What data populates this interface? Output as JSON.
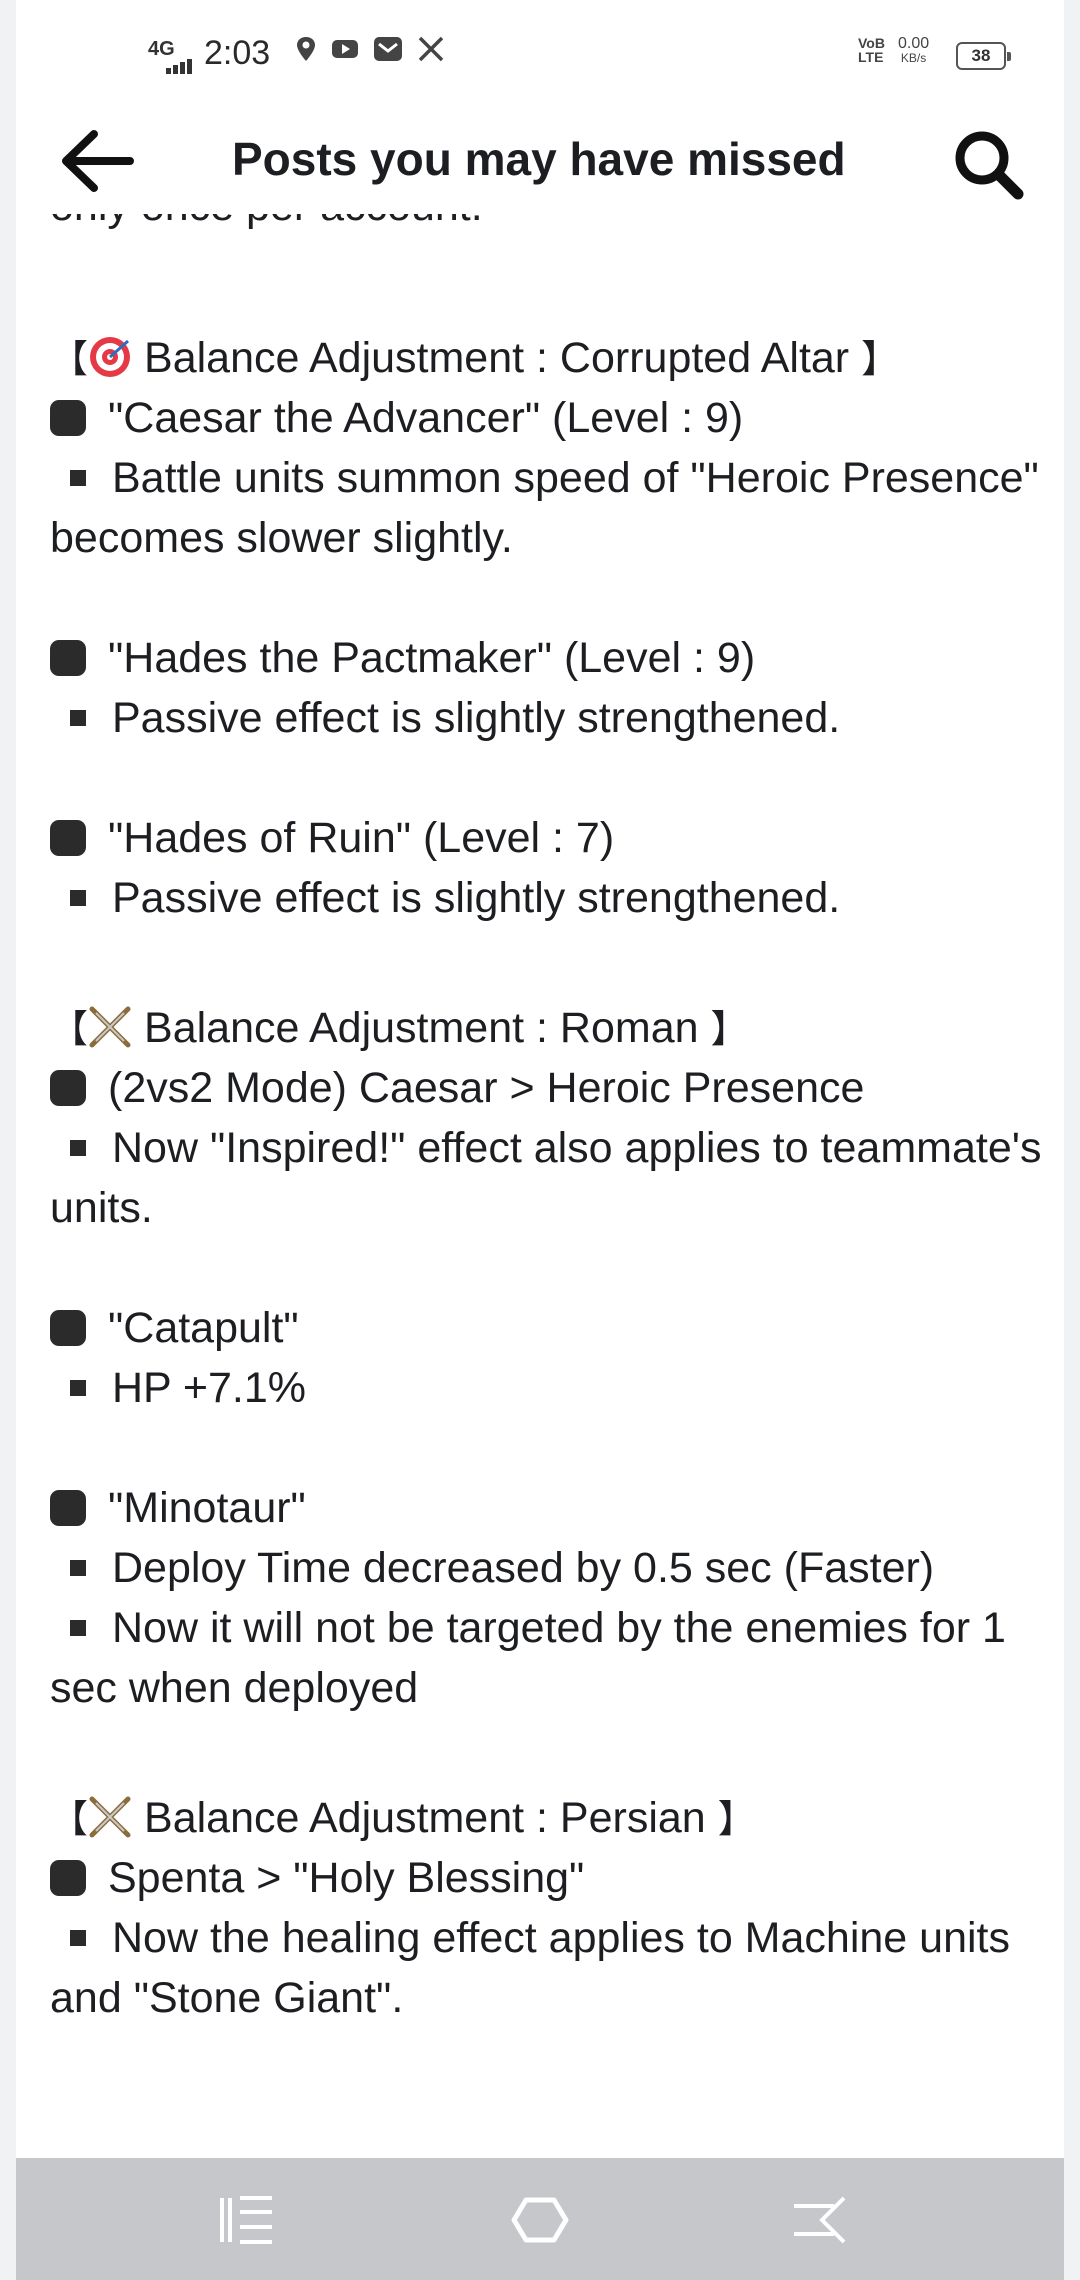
{
  "status_bar": {
    "network": "4G",
    "time": "2:03",
    "volte": "VoB",
    "lte": "LTE",
    "speed_value": "0.00",
    "speed_unit": "KB/s",
    "battery": "38"
  },
  "header": {
    "title": "Posts you may have missed"
  },
  "post": {
    "cut_off_text": "only once per account.",
    "sections": [
      {
        "bracket_open": "【",
        "icon": "target-icon",
        "heading": "Balance Adjustment : Corrupted Altar",
        "bracket_close": "】",
        "items": [
          {
            "title": "\"Caesar the Advancer\" (Level : 9)",
            "details": [
              "Battle units summon speed of \"Heroic Presence\" becomes slower slightly."
            ]
          },
          {
            "title": "\"Hades the Pactmaker\" (Level : 9)",
            "details": [
              "Passive effect is slightly strengthened."
            ]
          },
          {
            "title": "\"Hades of Ruin\" (Level : 7)",
            "details": [
              "Passive effect is slightly strengthened."
            ]
          }
        ]
      },
      {
        "bracket_open": "【",
        "icon": "crossed-swords-icon",
        "heading": "Balance Adjustment : Roman",
        "bracket_close": "】",
        "items": [
          {
            "title": "(2vs2 Mode) Caesar > Heroic Presence",
            "details": [
              "Now \"Inspired!\" effect also applies to teammate's units."
            ]
          },
          {
            "title": "\"Catapult\"",
            "details": [
              "HP +7.1%"
            ]
          },
          {
            "title": "\"Minotaur\"",
            "details": [
              "Deploy Time decreased by 0.5 sec (Faster)",
              "Now it will not be targeted by the enemies for 1 sec when deployed"
            ]
          }
        ]
      },
      {
        "bracket_open": "【",
        "icon": "crossed-swords-icon",
        "heading": "Balance Adjustment : Persian",
        "bracket_close": "】",
        "items": [
          {
            "title": "Spenta > \"Holy Blessing\"",
            "details": [
              "Now the healing effect applies to Machine units and \"Stone Giant\"."
            ]
          }
        ]
      }
    ]
  },
  "nav_bar": {
    "icons": [
      "recent-apps-icon",
      "home-icon",
      "back-gesture-icon"
    ]
  }
}
